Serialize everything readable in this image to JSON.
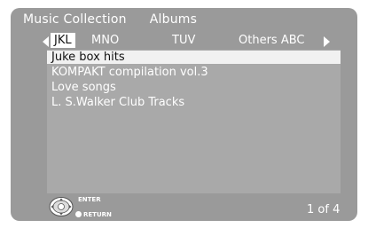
{
  "header": {
    "title": "Music Collection",
    "subtitle": "Albums"
  },
  "tabs": {
    "active": "JKL",
    "mno": "MNO",
    "tuv": "TUV",
    "others": "Others ABC"
  },
  "list": {
    "items": [
      "Juke box hits",
      "KOMPAKT compilation vol.3",
      "Love songs",
      "L. S.Walker Club Tracks"
    ],
    "selected_index": 0
  },
  "footer": {
    "enter_label": "ENTER",
    "return_label": "RETURN",
    "page_indicator": "1  of 4",
    "icon": "joystick-icon"
  },
  "colors": {
    "background": "#9a9a9a",
    "list_panel": "#a9a9a9",
    "highlight": "#f1f1f1",
    "text": "#ffffff"
  }
}
